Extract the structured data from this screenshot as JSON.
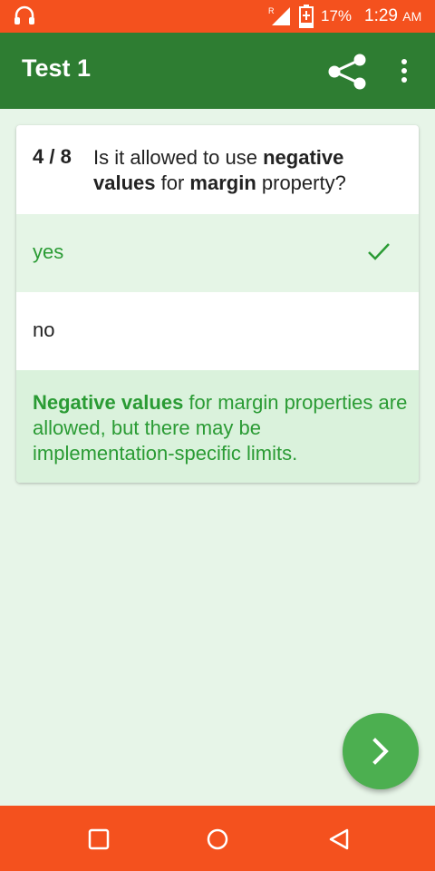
{
  "status_bar": {
    "battery_percent": "17%",
    "time": "1:29",
    "ampm": "AM",
    "signal_label": "R",
    "icons": [
      "headset-icon",
      "signal-icon",
      "battery-charging-icon"
    ]
  },
  "app_bar": {
    "title": "Test 1",
    "icons": [
      "share-icon",
      "more-vert-icon"
    ]
  },
  "question": {
    "counter": "4 / 8",
    "parts": [
      "Is it allowed to use ",
      "negative values",
      " for ",
      "margin",
      " property?"
    ]
  },
  "answers": [
    {
      "label": "yes",
      "selected": true,
      "correct": true
    },
    {
      "label": "no",
      "selected": false,
      "correct": false
    }
  ],
  "explanation": {
    "bold": "Negative values",
    "rest": " for margin properties are allowed, but there may be implementation-specific limits."
  },
  "fab": {
    "icon": "chevron-right-icon"
  },
  "nav_bar": {
    "icons": [
      "recents-square-icon",
      "home-circle-icon",
      "back-triangle-icon"
    ]
  },
  "colors": {
    "status_bar": "#f4511e",
    "app_bar": "#2e7d32",
    "background": "#e7f5e8",
    "correct_text": "#2a9b34",
    "fab": "#4caf50"
  }
}
